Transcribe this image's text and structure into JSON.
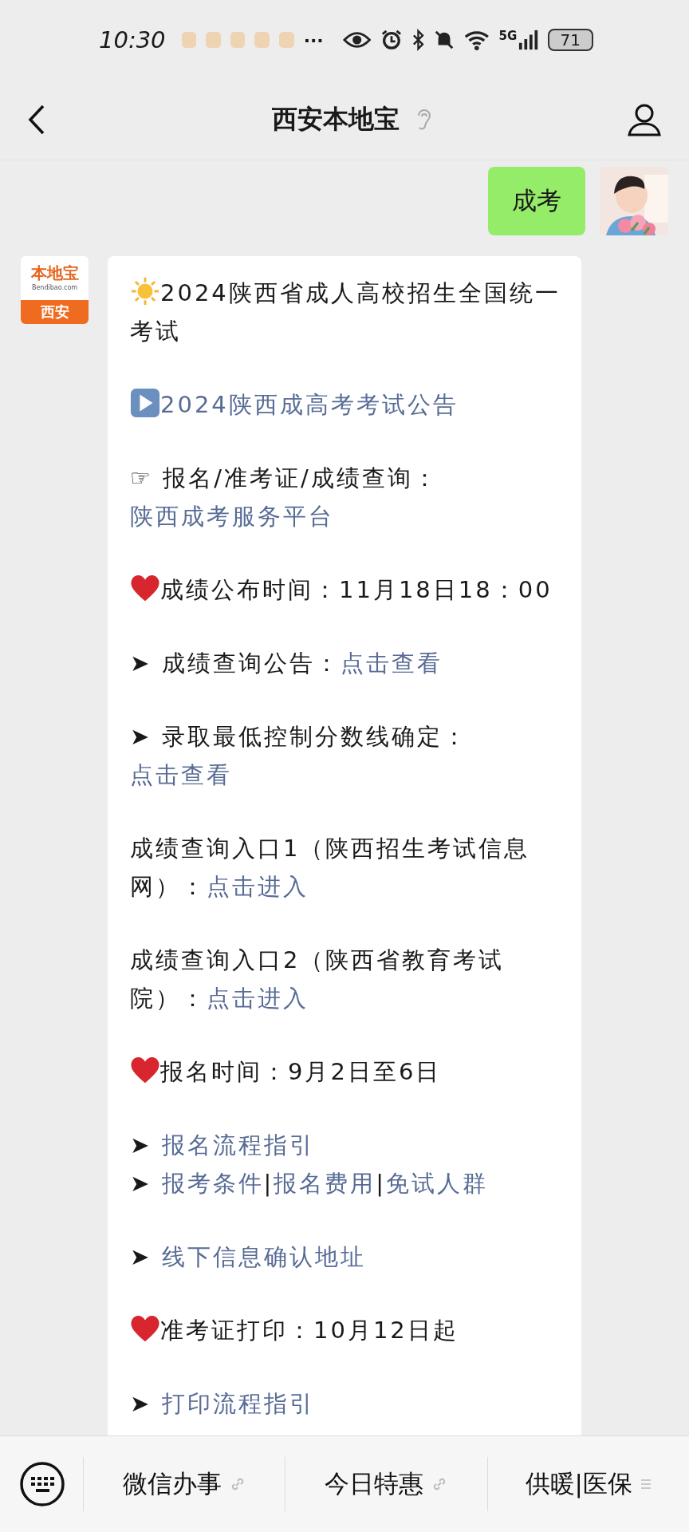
{
  "status_bar": {
    "time": "10:30",
    "more": "···",
    "network": "5G",
    "battery": "71"
  },
  "header": {
    "title": "西安本地宝"
  },
  "outgoing": {
    "text": "成考"
  },
  "incoming": {
    "avatar": {
      "brand": "本地宝",
      "domain": "Bendibao.com",
      "city": "西安"
    },
    "blocks": [
      {
        "lines": [
          {
            "kind": "sun",
            "segments": [
              {
                "kind": "plain",
                "text": "2024陕西省成人高校招生全国统一考试"
              }
            ]
          }
        ]
      },
      {
        "lines": [
          {
            "kind": "play",
            "segments": [
              {
                "kind": "link",
                "text": "2024陕西成高考考试公告"
              }
            ]
          }
        ]
      },
      {
        "lines": [
          {
            "segments": [
              {
                "kind": "plain",
                "text": "☞ 报名/准考证/成绩查询："
              },
              {
                "kind": "link",
                "text": "陕西成考服务平台"
              }
            ]
          }
        ]
      },
      {
        "lines": [
          {
            "kind": "heart",
            "segments": [
              {
                "kind": "plain",
                "text": "成绩公布时间：11月18日18：00"
              }
            ]
          }
        ]
      },
      {
        "lines": [
          {
            "segments": [
              {
                "kind": "plain",
                "text": "➤ 成绩查询公告："
              },
              {
                "kind": "link",
                "text": "点击查看"
              }
            ]
          }
        ]
      },
      {
        "lines": [
          {
            "segments": [
              {
                "kind": "plain",
                "text": "➤ 录取最低控制分数线确定："
              },
              {
                "kind": "link",
                "text": "点击查看"
              }
            ]
          }
        ]
      },
      {
        "lines": [
          {
            "segments": [
              {
                "kind": "plain",
                "text": "成绩查询入口1（陕西招生考试信息网）："
              },
              {
                "kind": "link",
                "text": "点击进入"
              }
            ]
          }
        ]
      },
      {
        "lines": [
          {
            "segments": [
              {
                "kind": "plain",
                "text": "成绩查询入口2（陕西省教育考试院）："
              },
              {
                "kind": "link",
                "text": "点击进入"
              }
            ]
          }
        ]
      },
      {
        "lines": [
          {
            "kind": "heart",
            "segments": [
              {
                "kind": "plain",
                "text": "报名时间：9月2日至6日"
              }
            ]
          }
        ]
      },
      {
        "lines": [
          {
            "segments": [
              {
                "kind": "plain",
                "text": "➤ "
              },
              {
                "kind": "link",
                "text": "报名流程指引"
              }
            ]
          },
          {
            "segments": [
              {
                "kind": "plain",
                "text": "➤ "
              },
              {
                "kind": "link",
                "text": "报考条件"
              },
              {
                "kind": "plain",
                "text": "|"
              },
              {
                "kind": "link",
                "text": "报名费用"
              },
              {
                "kind": "plain",
                "text": "|"
              },
              {
                "kind": "link",
                "text": "免试人群"
              }
            ]
          }
        ]
      },
      {
        "lines": [
          {
            "segments": [
              {
                "kind": "plain",
                "text": "➤ "
              },
              {
                "kind": "link",
                "text": "线下信息确认地址"
              }
            ]
          }
        ]
      },
      {
        "lines": [
          {
            "kind": "heart",
            "segments": [
              {
                "kind": "plain",
                "text": "准考证打印：10月12日起"
              }
            ]
          }
        ]
      },
      {
        "lines": [
          {
            "segments": [
              {
                "kind": "plain",
                "text": "➤ "
              },
              {
                "kind": "link",
                "text": "打印流程指引"
              }
            ]
          }
        ]
      }
    ]
  },
  "menu_bar": {
    "items": [
      {
        "label": "微信办事",
        "kind": "link"
      },
      {
        "label": "今日特惠",
        "kind": "link"
      },
      {
        "label": "供暖|医保",
        "kind": "list"
      }
    ]
  }
}
